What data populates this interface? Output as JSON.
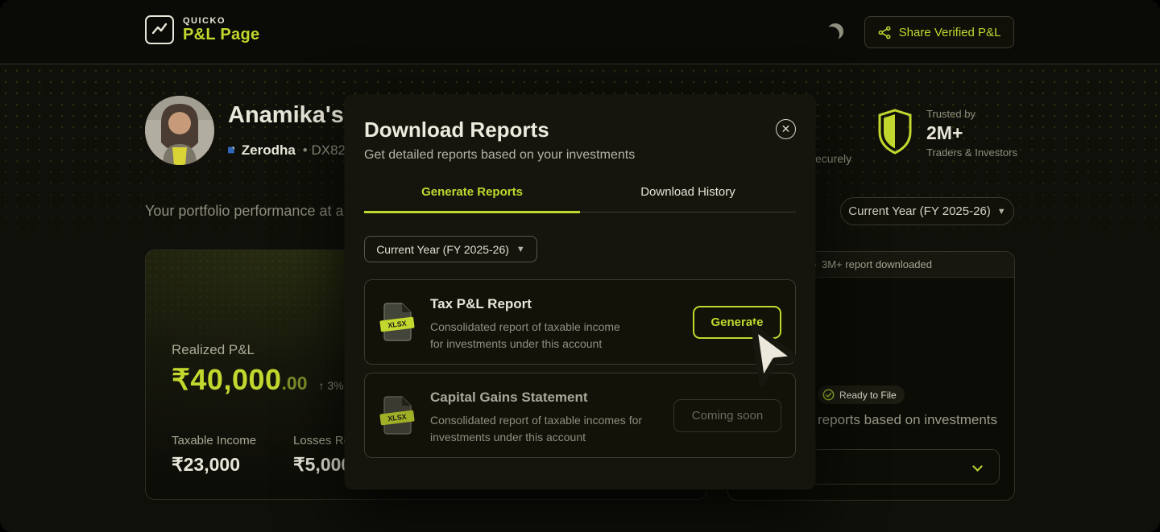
{
  "header": {
    "brand_top": "QUICKO",
    "brand_bottom": "P&L Page",
    "share_label": "Share Verified P&L"
  },
  "profile": {
    "name": "Anamika's P",
    "broker": "Zerodha",
    "account": "• DX82"
  },
  "overview": {
    "caption": "Your portfolio performance at a glance",
    "partial_tagline": "ecurely",
    "year_filter": "Current Year (FY 2025-26)",
    "trusted_label": "Trusted by",
    "trusted_count": "2M+",
    "trusted_audience": "Traders & Investors"
  },
  "pnl_card": {
    "realized_label": "Realized P&L",
    "amount_main": "₹40,000",
    "amount_decimal": ".00",
    "change_text": "↑ 3%",
    "metrics": [
      {
        "label": "Taxable Income",
        "value": "₹23,000"
      },
      {
        "label": "Losses Re",
        "value": "₹5,000"
      }
    ]
  },
  "reports_card": {
    "banner": "3M+ report downloaded",
    "ready_badge": "Ready to File",
    "caption": "reports based on investments"
  },
  "modal": {
    "title": "Download Reports",
    "subtitle": "Get detailed reports based on your investments",
    "close_glyph": "✕",
    "tabs": [
      {
        "label": "Generate Reports"
      },
      {
        "label": "Download History"
      }
    ],
    "year_filter": "Current Year (FY 2025-26)",
    "items": [
      {
        "title": "Tax P&L Report",
        "file_type": "XLSX",
        "desc_line1": "Consolidated report of taxable income",
        "desc_line2": "for investments under this account",
        "action": "Generate"
      },
      {
        "title": "Capital Gains Statement",
        "file_type": "XLSX",
        "desc_line1": "Consolidated report of taxable incomes for",
        "desc_line2": "investments under this account",
        "action": "Coming soon"
      }
    ]
  },
  "colors": {
    "accent": "#c3d82e",
    "cream": "#e9e7da",
    "muted": "#8f8f7f"
  }
}
